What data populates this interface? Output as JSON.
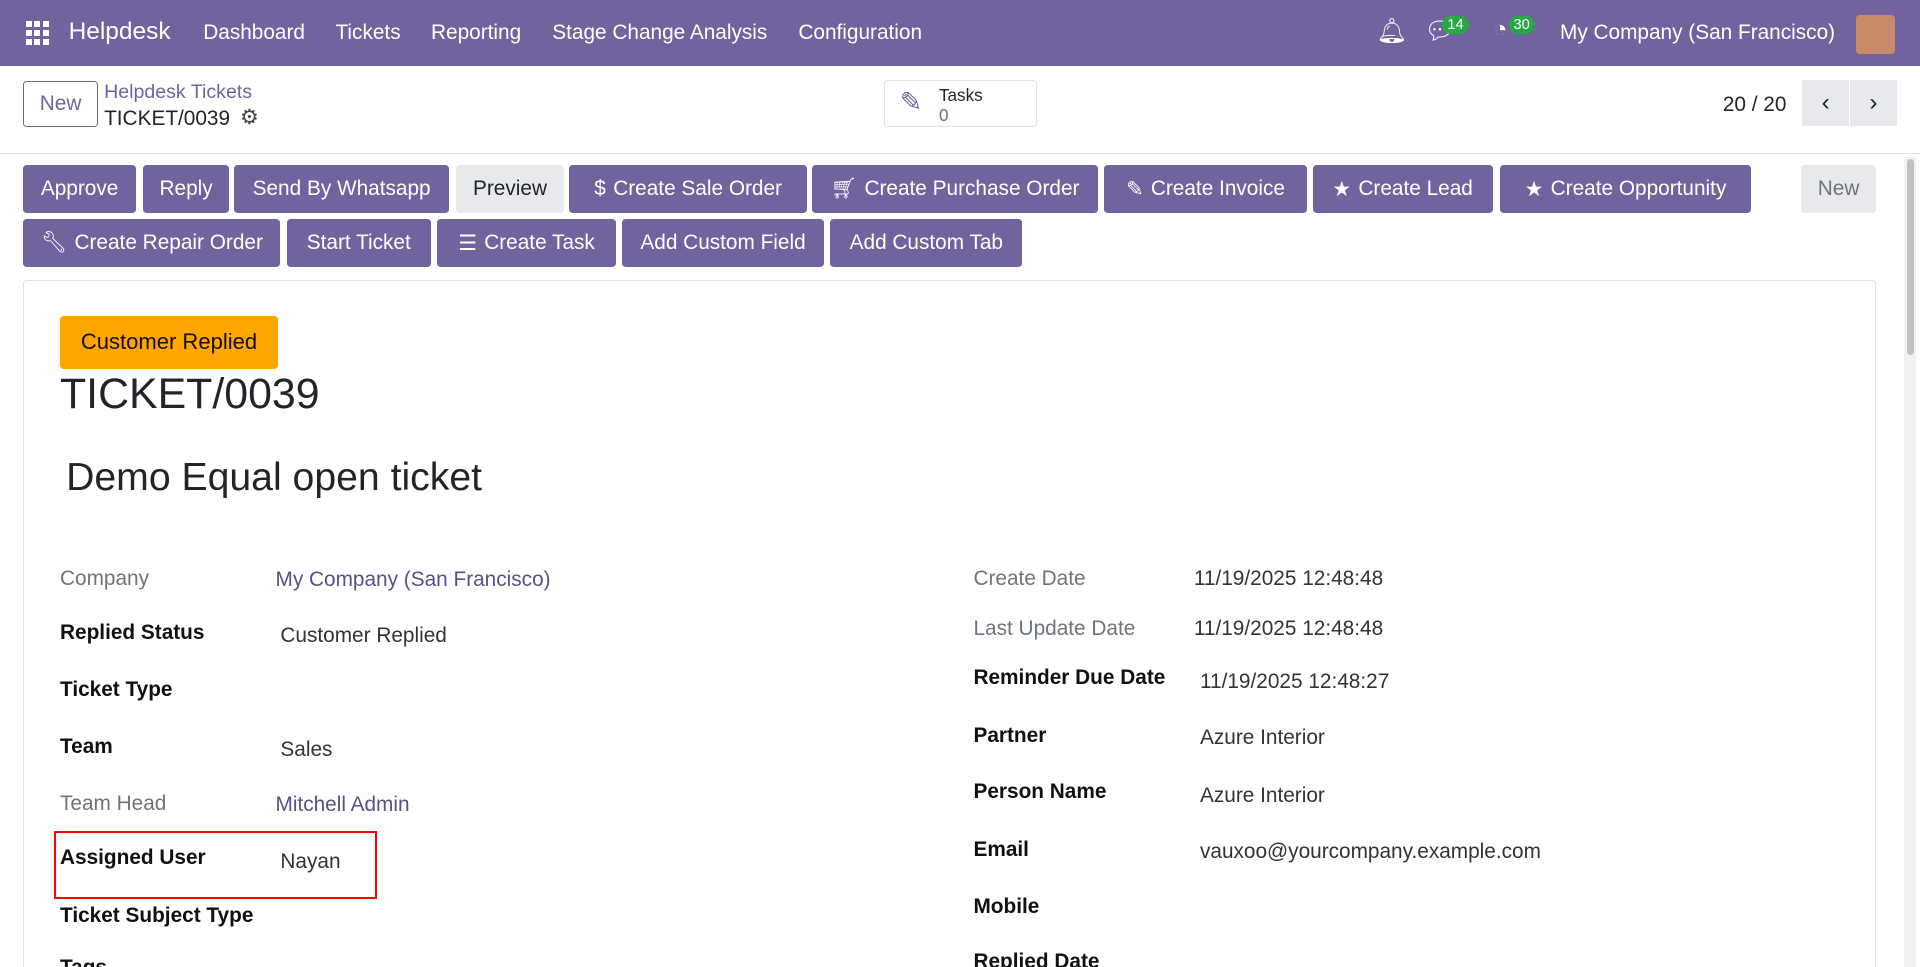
{
  "nav": {
    "brand": "Helpdesk",
    "menu": [
      "Dashboard",
      "Tickets",
      "Reporting",
      "Stage Change Analysis",
      "Configuration"
    ],
    "messages_count": "14",
    "activities_count": "30",
    "company": "My Company (San Francisco)"
  },
  "control": {
    "new_label": "New",
    "breadcrumb_parent": "Helpdesk Tickets",
    "breadcrumb_current": "TICKET/0039",
    "tasks_label": "Tasks",
    "tasks_count": "0",
    "pager": "20 / 20"
  },
  "actions": {
    "row1": [
      "Approve",
      "Reply",
      "Send By Whatsapp",
      "Preview",
      "Create Sale Order",
      "Create Purchase Order",
      "Create Invoice",
      "Create Lead",
      "Create Opportunity"
    ],
    "new_label": "New",
    "row2": [
      "Create Repair Order",
      "Start Ticket",
      "Create Task",
      "Add Custom Field",
      "Add Custom Tab"
    ]
  },
  "form": {
    "status": "Customer Replied",
    "ticket_number": "TICKET/0039",
    "subject": "Demo Equal open ticket",
    "left": [
      {
        "label": "Company",
        "value": "My Company (San Francisco)"
      },
      {
        "label": "Replied Status",
        "value": "Customer Replied"
      },
      {
        "label": "Ticket Type",
        "value": ""
      },
      {
        "label": "Team",
        "value": "Sales"
      },
      {
        "label": "Team Head",
        "value": "Mitchell Admin"
      },
      {
        "label": "Assigned User",
        "value": "Nayan"
      },
      {
        "label": "Ticket Subject Type",
        "value": ""
      },
      {
        "label": "Tags",
        "value": ""
      }
    ],
    "right": [
      {
        "label": "Create Date",
        "value": "11/19/2025 12:48:48"
      },
      {
        "label": "Last Update Date",
        "value": "11/19/2025 12:48:48"
      },
      {
        "label": "Reminder Due Date",
        "value": "11/19/2025 12:48:27"
      },
      {
        "label": "Partner",
        "value": "Azure Interior"
      },
      {
        "label": "Person Name",
        "value": "Azure Interior"
      },
      {
        "label": "Email",
        "value": "vauxoo@yourcompany.example.com"
      },
      {
        "label": "Mobile",
        "value": ""
      },
      {
        "label": "Replied Date",
        "value": ""
      }
    ]
  },
  "colors": {
    "primary": "#71639e",
    "status": "#ffa500",
    "highlight": "#ff0000"
  }
}
